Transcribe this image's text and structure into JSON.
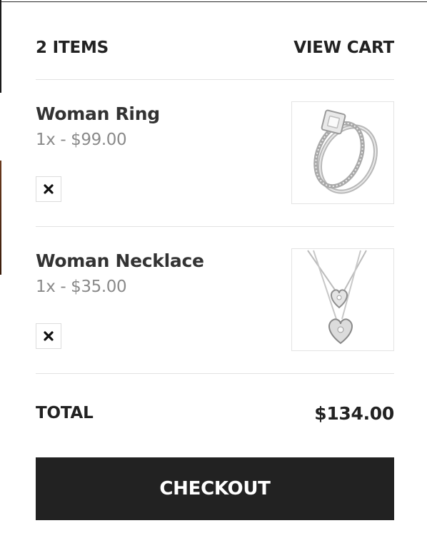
{
  "header": {
    "item_count": "2 ITEMS",
    "view_cart_label": "VIEW CART"
  },
  "cart": {
    "items": [
      {
        "name": "Woman Ring",
        "qty_price": "1x - $99.00",
        "remove_icon": "close-icon",
        "image_icon": "ring-icon"
      },
      {
        "name": "Woman Necklace",
        "qty_price": "1x - $35.00",
        "remove_icon": "close-icon",
        "image_icon": "necklace-icon"
      }
    ]
  },
  "summary": {
    "total_label": "TOTAL",
    "total_value": "$134.00"
  },
  "checkout": {
    "label": "CHECKOUT"
  },
  "colors": {
    "button_bg": "#222222",
    "text_dark": "#2b2b2b",
    "text_muted": "#8a8a8a",
    "divider": "#e2e2e2"
  }
}
